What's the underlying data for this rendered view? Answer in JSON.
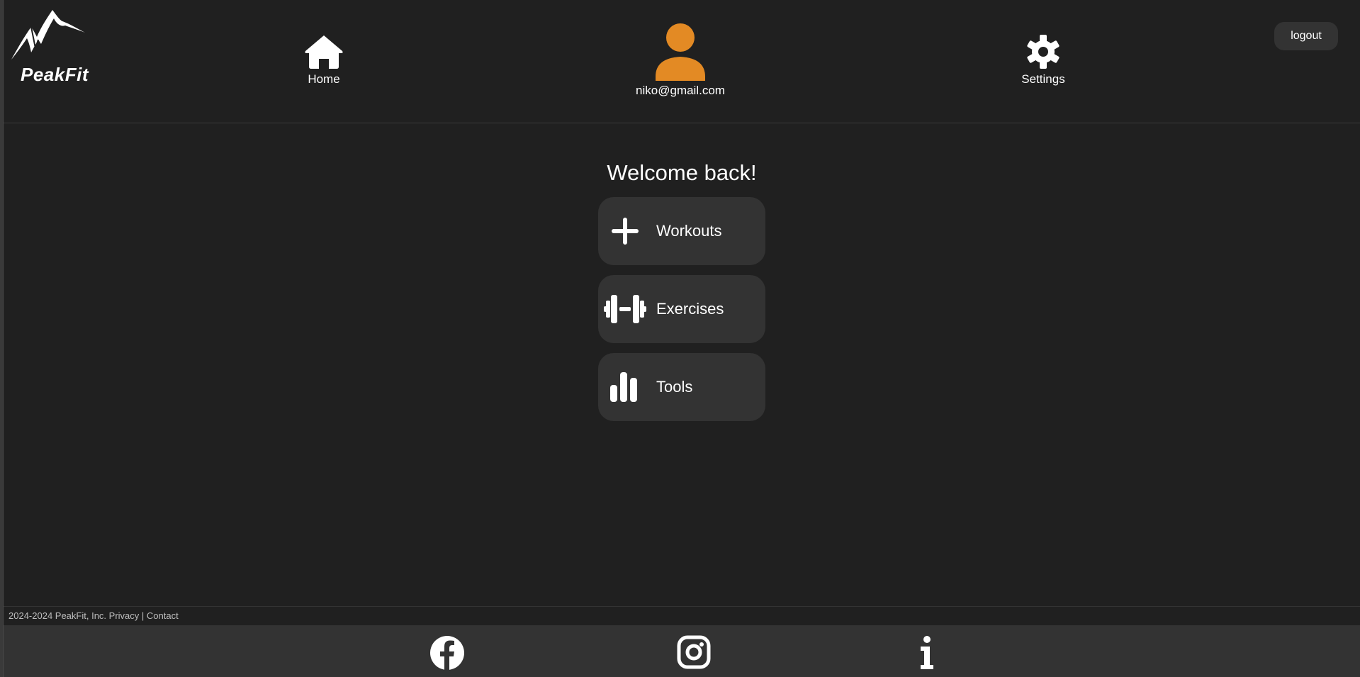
{
  "header": {
    "logo_text": "PeakFit",
    "nav": {
      "home_label": "Home",
      "profile_label": "niko@gmail.com",
      "settings_label": "Settings"
    },
    "logout_label": "logout"
  },
  "main": {
    "welcome": "Welcome back!",
    "cards": [
      {
        "label": "Workouts",
        "icon": "plus-icon"
      },
      {
        "label": "Exercises",
        "icon": "dumbbell-icon"
      },
      {
        "label": "Tools",
        "icon": "bar-chart-icon"
      }
    ]
  },
  "footer": {
    "copyright": "2024-2024 PeakFit, Inc.",
    "privacy": "Privacy",
    "separator": "|",
    "contact": "Contact"
  },
  "social": {
    "icons": [
      "facebook-icon",
      "instagram-icon",
      "info-icon"
    ]
  },
  "colors": {
    "background": "#202020",
    "card": "#333333",
    "accent": "#e38a24",
    "text": "#ffffff"
  }
}
